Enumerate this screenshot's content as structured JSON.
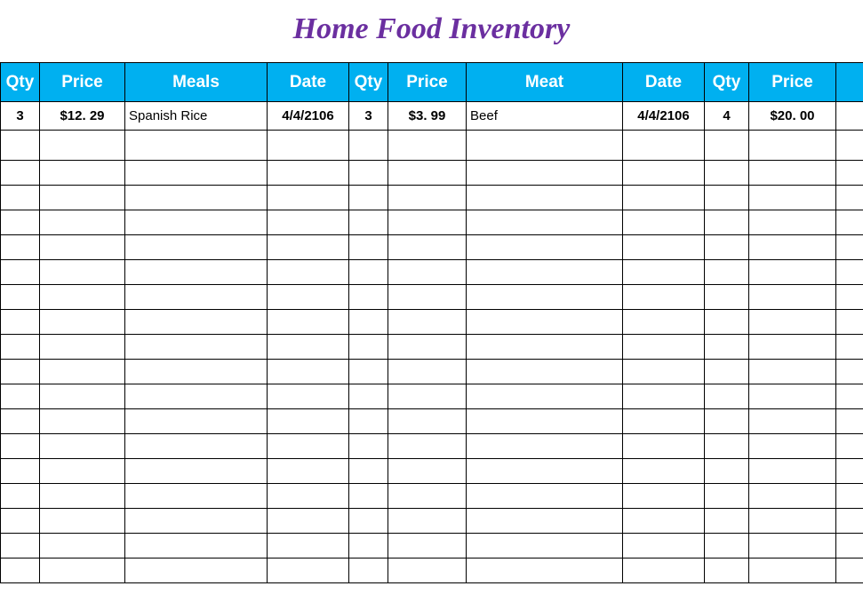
{
  "title": "Home Food Inventory",
  "headers": {
    "qty1": "Qty",
    "price1": "Price",
    "meals": "Meals",
    "date1": "Date",
    "qty2": "Qty",
    "price2": "Price",
    "meat": "Meat",
    "date2": "Date",
    "qty3": "Qty",
    "price3": "Price",
    "extra": ""
  },
  "rows": [
    {
      "qty1": "3",
      "price1": "$12. 29",
      "meals": "Spanish Rice",
      "date1": "4/4/2106",
      "qty2": "3",
      "price2": "$3. 99",
      "meat": "Beef",
      "date2": "4/4/2106",
      "qty3": "4",
      "price3": "$20. 00",
      "extra": ""
    }
  ],
  "emptyRowCount": 17
}
